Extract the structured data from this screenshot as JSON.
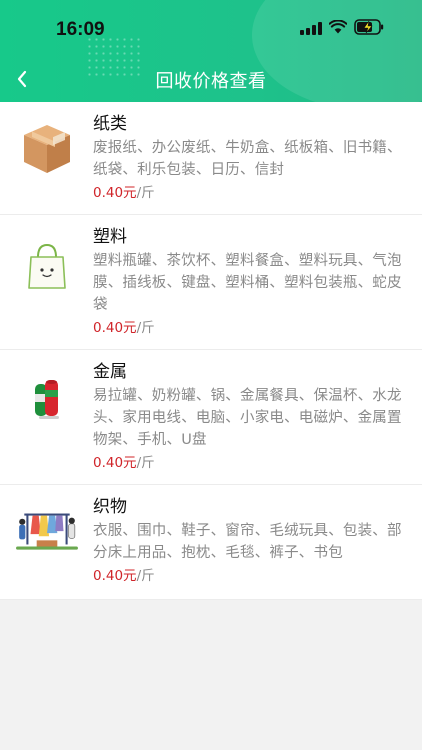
{
  "status_bar": {
    "time": "16:09"
  },
  "nav": {
    "title": "回收价格查看",
    "back_icon": "chevron-left-icon"
  },
  "categories": [
    {
      "name": "纸类",
      "desc": "废报纸、办公废纸、牛奶盒、纸板箱、旧书籍、纸袋、利乐包装、日历、信封",
      "price": "0.40元",
      "unit": "/斤",
      "icon": "cardboard-box-icon"
    },
    {
      "name": "塑料",
      "desc": "塑料瓶罐、茶饮杯、塑料餐盒、塑料玩具、气泡膜、插线板、键盘、塑料桶、塑料包装瓶、蛇皮袋",
      "price": "0.40元",
      "unit": "/斤",
      "icon": "shopping-bag-icon"
    },
    {
      "name": "金属",
      "desc": "易拉罐、奶粉罐、锅、金属餐具、保温杯、水龙头、家用电线、电脑、小家电、电磁炉、金属置物架、手机、U盘",
      "price": "0.40元",
      "unit": "/斤",
      "icon": "metal-cans-icon"
    },
    {
      "name": "织物",
      "desc": "衣服、围巾、鞋子、窗帘、毛绒玩具、包装、部分床上用品、抱枕、毛毯、裤子、书包",
      "price": "0.40元",
      "unit": "/斤",
      "icon": "clothes-rack-icon"
    }
  ],
  "colors": {
    "header": "#1ec28b",
    "price": "#d0252a",
    "desc": "#8a8a8a"
  }
}
